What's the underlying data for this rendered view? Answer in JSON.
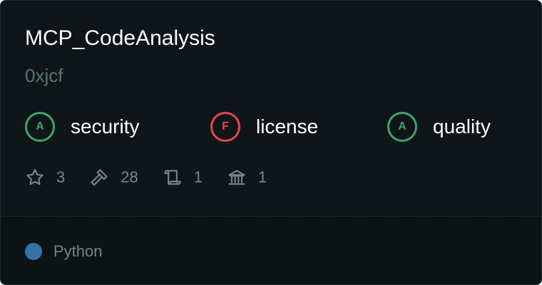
{
  "repo": {
    "name": "MCP_CodeAnalysis",
    "owner": "0xjcf"
  },
  "grades": {
    "security": {
      "grade": "A",
      "label": "security",
      "status_color": "#3fa46a"
    },
    "license": {
      "grade": "F",
      "label": "license",
      "status_color": "#e5484d"
    },
    "quality": {
      "grade": "A",
      "label": "quality",
      "status_color": "#3fa46a"
    }
  },
  "stats": {
    "stars": {
      "icon": "star-icon",
      "value": "3"
    },
    "tools": {
      "icon": "hammer-icon",
      "value": "28"
    },
    "scrolls": {
      "icon": "scroll-icon",
      "value": "1"
    },
    "institutions": {
      "icon": "bank-icon",
      "value": "1"
    }
  },
  "language": {
    "name": "Python",
    "color": "#3572a5"
  }
}
